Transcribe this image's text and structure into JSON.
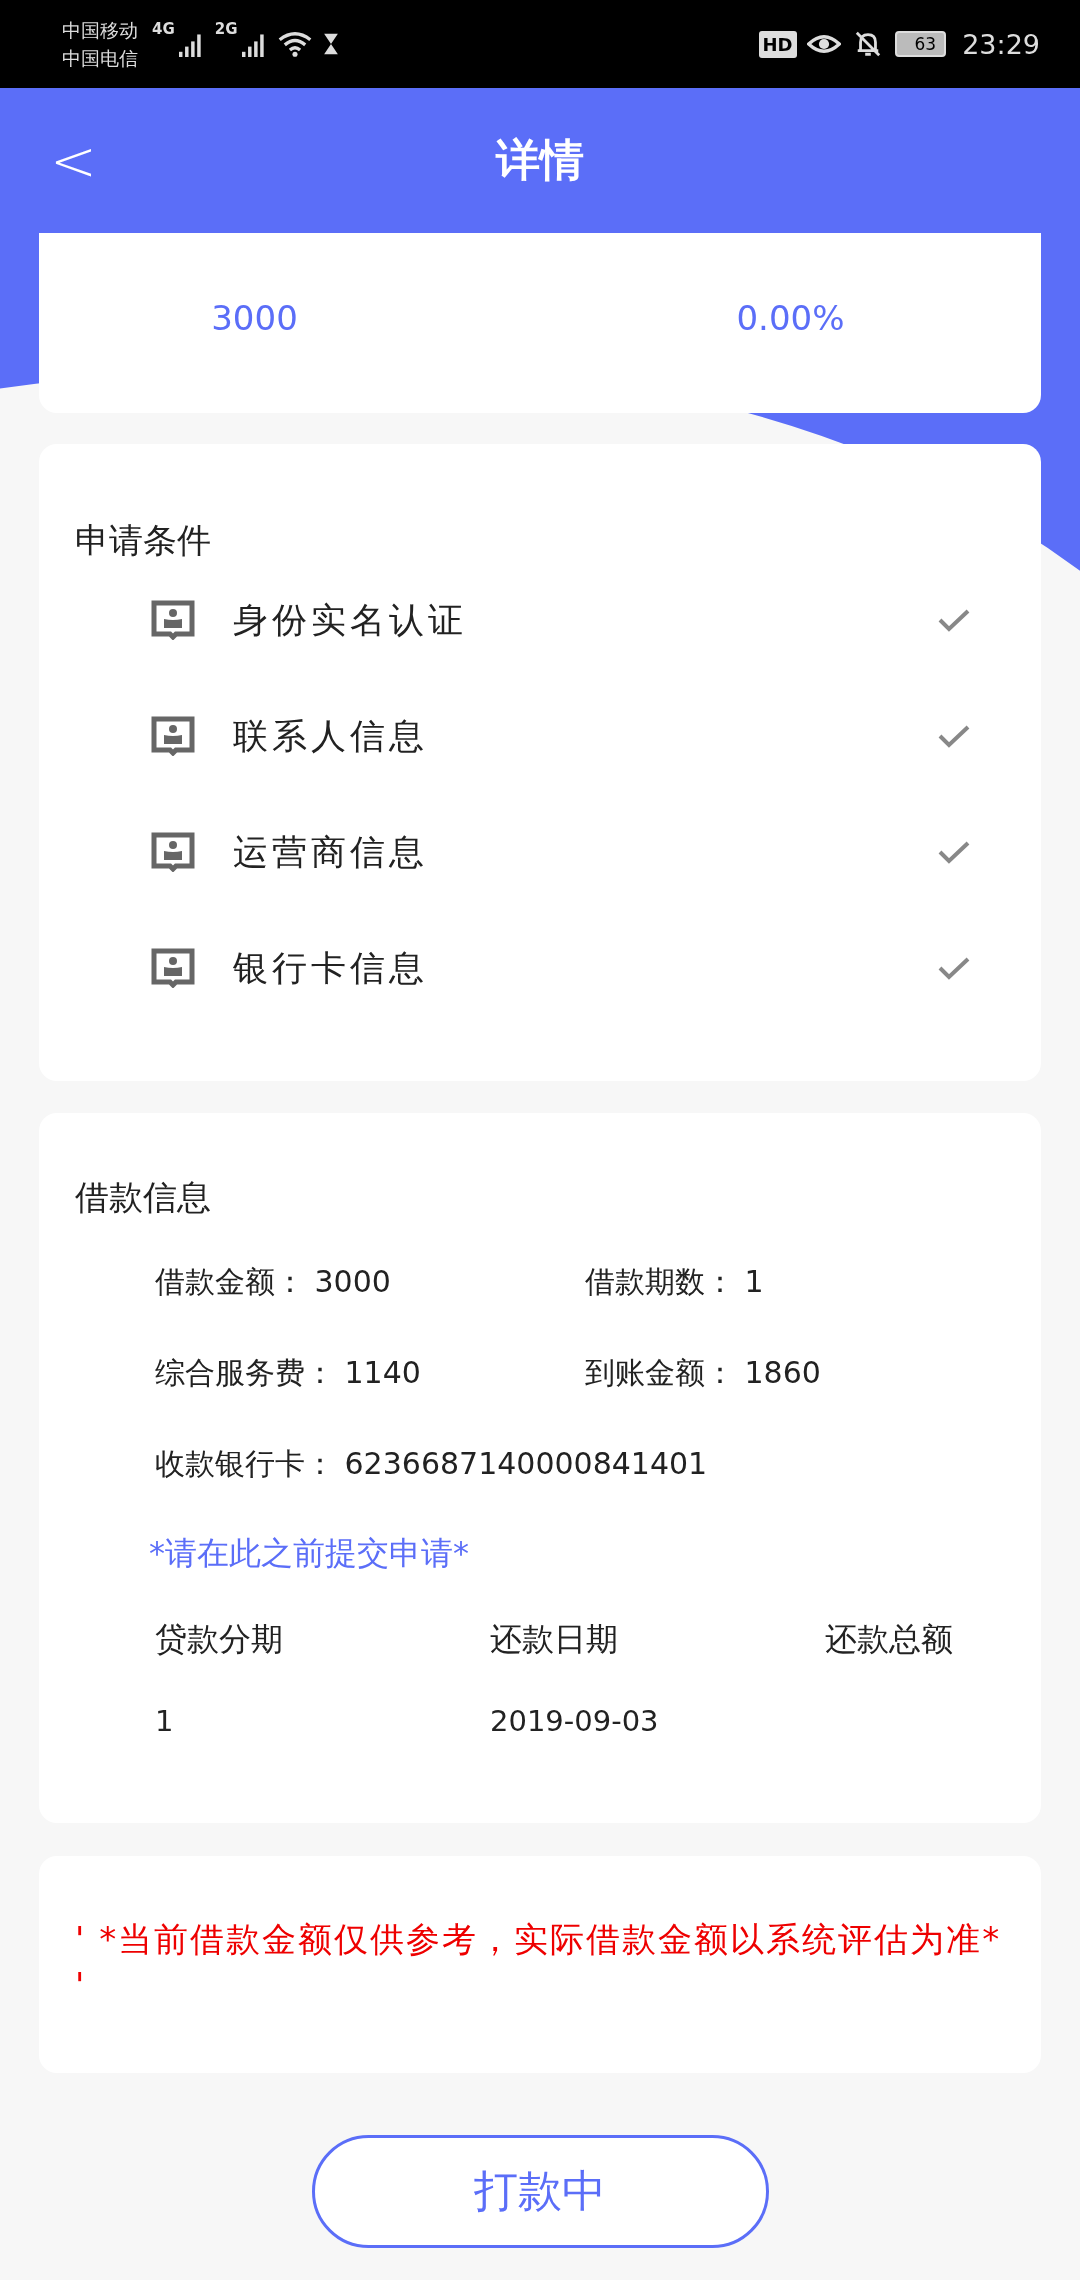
{
  "status_bar": {
    "carriers": [
      "中国移动",
      "中国电信"
    ],
    "networks": [
      "4G",
      "2G"
    ],
    "hd": "HD",
    "battery": "63",
    "time": "23:29"
  },
  "header": {
    "back": "<",
    "title": "详情"
  },
  "summary": {
    "values": [
      "3000",
      "0.00%"
    ]
  },
  "conditions": {
    "title": "申请条件",
    "items": [
      {
        "label": "身份实名认证",
        "checked": true
      },
      {
        "label": "联系人信息",
        "checked": true
      },
      {
        "label": "运营商信息",
        "checked": true
      },
      {
        "label": "银行卡信息",
        "checked": true
      }
    ]
  },
  "loan": {
    "title": "借款信息",
    "fields": [
      {
        "label": "借款金额：",
        "value": "3000"
      },
      {
        "label": "借款期数：",
        "value": "1"
      },
      {
        "label": "综合服务费：",
        "value": "1140"
      },
      {
        "label": "到账金额：",
        "value": "1860"
      }
    ],
    "card": {
      "label": "收款银行卡：",
      "value": "6236687140000841401"
    },
    "note": "*请在此之前提交申请*",
    "table": {
      "columns": [
        "贷款分期",
        "还款日期",
        "还款总额"
      ],
      "rows": [
        [
          "1",
          "2019-09-03"
        ]
      ]
    }
  },
  "notice": "' *当前借款金额仅供参考，实际借款金额以系统评估为准* '",
  "button": "打款中"
}
